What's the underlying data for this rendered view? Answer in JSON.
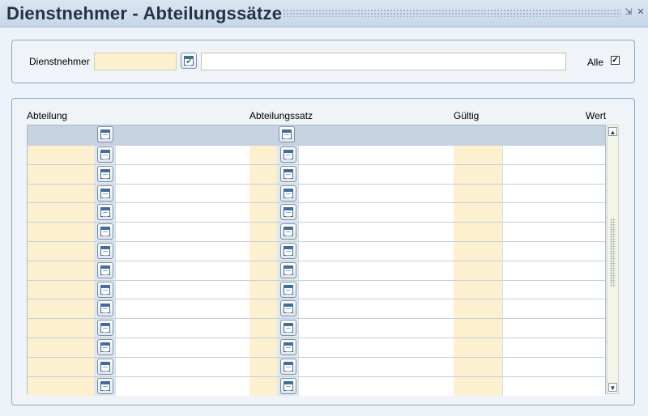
{
  "window": {
    "title": "Dienstnehmer - Abteilungssätze",
    "minimize_glyph": "⇲",
    "close_glyph": "✕"
  },
  "filter_panel": {
    "employee_label": "Dienstnehmer",
    "employee_code_value": "",
    "employee_name_value": "",
    "all_label": "Alle",
    "all_checked": true,
    "all_check_glyph": "✓",
    "lookup_icon": "calendar-check-icon"
  },
  "grid": {
    "columns": [
      "Abteilung",
      "Abteilungssatz",
      "Gültig",
      "Wert"
    ],
    "filter_row": {
      "abteilung": "",
      "abteilungssatz": ""
    },
    "rows": [
      {
        "abteilung": "",
        "abteilung_name": "",
        "satz": "",
        "satz_name": "",
        "gueltig": "",
        "wert": ""
      },
      {
        "abteilung": "",
        "abteilung_name": "",
        "satz": "",
        "satz_name": "",
        "gueltig": "",
        "wert": ""
      },
      {
        "abteilung": "",
        "abteilung_name": "",
        "satz": "",
        "satz_name": "",
        "gueltig": "",
        "wert": ""
      },
      {
        "abteilung": "",
        "abteilung_name": "",
        "satz": "",
        "satz_name": "",
        "gueltig": "",
        "wert": ""
      },
      {
        "abteilung": "",
        "abteilung_name": "",
        "satz": "",
        "satz_name": "",
        "gueltig": "",
        "wert": ""
      },
      {
        "abteilung": "",
        "abteilung_name": "",
        "satz": "",
        "satz_name": "",
        "gueltig": "",
        "wert": ""
      },
      {
        "abteilung": "",
        "abteilung_name": "",
        "satz": "",
        "satz_name": "",
        "gueltig": "",
        "wert": ""
      },
      {
        "abteilung": "",
        "abteilung_name": "",
        "satz": "",
        "satz_name": "",
        "gueltig": "",
        "wert": ""
      },
      {
        "abteilung": "",
        "abteilung_name": "",
        "satz": "",
        "satz_name": "",
        "gueltig": "",
        "wert": ""
      },
      {
        "abteilung": "",
        "abteilung_name": "",
        "satz": "",
        "satz_name": "",
        "gueltig": "",
        "wert": ""
      },
      {
        "abteilung": "",
        "abteilung_name": "",
        "satz": "",
        "satz_name": "",
        "gueltig": "",
        "wert": ""
      },
      {
        "abteilung": "",
        "abteilung_name": "",
        "satz": "",
        "satz_name": "",
        "gueltig": "",
        "wert": ""
      },
      {
        "abteilung": "",
        "abteilung_name": "",
        "satz": "",
        "satz_name": "",
        "gueltig": "",
        "wert": ""
      }
    ],
    "row_lookup_icon": "calendar-icon",
    "scroll_up_glyph": "▲",
    "scroll_down_glyph": "▼"
  },
  "colors": {
    "key_field": "#fdf0cf",
    "panel_border": "#8aa8c8",
    "filter_row": "#c5d2e2"
  }
}
